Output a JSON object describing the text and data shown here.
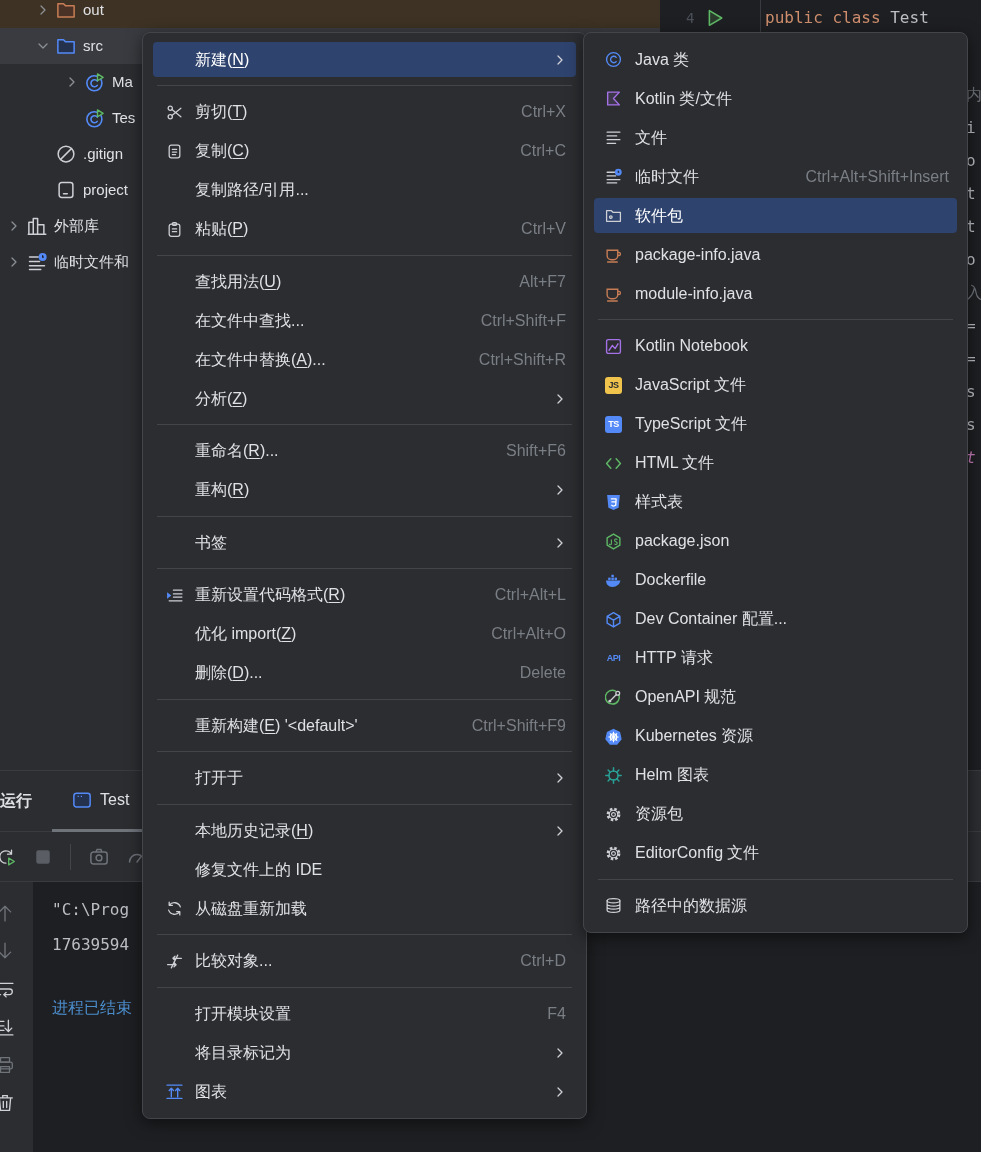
{
  "project_tree": {
    "root_children": [
      {
        "label": "out",
        "kind": "folder",
        "expanded": false,
        "selected": false,
        "excluded": true
      },
      {
        "label": "src",
        "kind": "folder",
        "expanded": true,
        "selected": true,
        "excluded": false,
        "children": [
          {
            "label": "Ma",
            "kind": "class",
            "expanded": false,
            "selected": false,
            "excluded": false
          },
          {
            "label": "Tes",
            "kind": "class",
            "selected": false,
            "excluded": false
          }
        ]
      },
      {
        "label": ".gitign",
        "kind": "ignore",
        "selected": false,
        "excluded": false
      },
      {
        "label": "project",
        "kind": "file",
        "selected": false,
        "excluded": false
      }
    ],
    "top_level": [
      {
        "label": "外部库",
        "kind": "library",
        "expanded": false,
        "selected": false,
        "excluded": false
      },
      {
        "label": "临时文件和",
        "kind": "scratch",
        "expanded": false,
        "selected": false,
        "excluded": false
      }
    ]
  },
  "editor": {
    "line_number": "4",
    "run_marker": true,
    "lines": [
      [
        {
          "text": "public class ",
          "kind": "keyword"
        },
        {
          "text": "Test",
          "kind": "plain"
        }
      ]
    ],
    "edge_fragments": [
      {
        "text": "内",
        "kind": "hint"
      },
      {
        "text": "i",
        "kind": "plain"
      },
      {
        "text": "o",
        "kind": "plain"
      },
      {
        "text": "t",
        "kind": "plain"
      },
      {
        "text": "t",
        "kind": "plain"
      },
      {
        "text": "o",
        "kind": "plain"
      },
      {
        "text": "入",
        "kind": "hint"
      },
      {
        "text": "=",
        "kind": "plain"
      },
      {
        "text": "=",
        "kind": "plain"
      },
      {
        "text": "s",
        "kind": "plain"
      },
      {
        "text": "s",
        "kind": "plain"
      },
      {
        "text": "t",
        "kind": "field"
      }
    ]
  },
  "run_panel": {
    "title": "运行",
    "tabs": [
      {
        "label": "Test",
        "selected": true
      }
    ],
    "console": [
      {
        "text": "\"C:\\Prog",
        "kind": "plain"
      },
      {
        "text": "17639594",
        "kind": "plain"
      },
      {
        "text": "进程已结束",
        "kind": "exit"
      }
    ]
  },
  "context_menu": {
    "groups": [
      [
        {
          "text": "新建(",
          "key": "N",
          "after": ")",
          "submenu": true,
          "selected": true
        }
      ],
      [
        {
          "kind": "scissors",
          "text": "剪切(",
          "key": "T",
          "after": ")",
          "shortcut": "Ctrl+X",
          "selected": false
        },
        {
          "kind": "copy",
          "text": "复制(",
          "key": "C",
          "after": ")",
          "shortcut": "Ctrl+C",
          "selected": false
        },
        {
          "text": "复制路径/引用...",
          "selected": false
        },
        {
          "kind": "paste",
          "text": "粘贴(",
          "key": "P",
          "after": ")",
          "shortcut": "Ctrl+V",
          "selected": false
        }
      ],
      [
        {
          "text": "查找用法(",
          "key": "U",
          "after": ")",
          "shortcut": "Alt+F7",
          "selected": false
        },
        {
          "text": "在文件中查找...",
          "shortcut": "Ctrl+Shift+F",
          "selected": false
        },
        {
          "text": "在文件中替换(",
          "key": "A",
          "after": ")...",
          "shortcut": "Ctrl+Shift+R",
          "selected": false
        },
        {
          "text": "分析(",
          "key": "Z",
          "after": ")",
          "submenu": true,
          "selected": false
        }
      ],
      [
        {
          "text": "重命名(",
          "key": "R",
          "after": ")...",
          "shortcut": "Shift+F6",
          "selected": false
        },
        {
          "text": "重构(",
          "key": "R",
          "after": ")",
          "submenu": true,
          "selected": false
        }
      ],
      [
        {
          "text": "书签",
          "submenu": true,
          "selected": false
        }
      ],
      [
        {
          "kind": "reformat",
          "text": "重新设置代码格式(",
          "key": "R",
          "after": ")",
          "shortcut": "Ctrl+Alt+L",
          "selected": false
        },
        {
          "text": "优化 import(",
          "key": "Z",
          "after": ")",
          "shortcut": "Ctrl+Alt+O",
          "selected": false
        },
        {
          "text": "删除(",
          "key": "D",
          "after": ")...",
          "shortcut": "Delete",
          "selected": false
        }
      ],
      [
        {
          "text": "重新构建(",
          "key": "E",
          "after": ") '<default>'",
          "shortcut": "Ctrl+Shift+F9",
          "selected": false
        }
      ],
      [
        {
          "text": "打开于",
          "submenu": true,
          "selected": false
        }
      ],
      [
        {
          "text": "本地历史记录(",
          "key": "H",
          "after": ")",
          "submenu": true,
          "selected": false
        },
        {
          "text": "修复文件上的 IDE",
          "selected": false
        },
        {
          "kind": "reload",
          "text": "从磁盘重新加载",
          "selected": false
        }
      ],
      [
        {
          "kind": "compare",
          "text": "比较对象...",
          "shortcut": "Ctrl+D",
          "selected": false
        }
      ],
      [
        {
          "text": "打开模块设置",
          "shortcut": "F4",
          "selected": false
        },
        {
          "text": "将目录标记为",
          "submenu": true,
          "selected": false
        },
        {
          "kind": "diagram",
          "text": "图表",
          "submenu": true,
          "selected": false
        }
      ]
    ]
  },
  "new_submenu": {
    "groups": [
      [
        {
          "kind": "java-class",
          "label": "Java 类",
          "selected": false
        },
        {
          "kind": "kotlin",
          "label": "Kotlin 类/文件",
          "selected": false
        },
        {
          "kind": "text-file",
          "label": "文件",
          "selected": false
        },
        {
          "kind": "scratch",
          "label": "临时文件",
          "shortcut": "Ctrl+Alt+Shift+Insert",
          "selected": false
        },
        {
          "kind": "package",
          "label": "软件包",
          "selected": true
        },
        {
          "kind": "cup",
          "label": "package-info.java",
          "selected": false
        },
        {
          "kind": "cup",
          "label": "module-info.java",
          "selected": false
        }
      ],
      [
        {
          "kind": "notebook",
          "label": "Kotlin Notebook",
          "selected": false
        },
        {
          "kind": "js",
          "icon_text": "JS",
          "label": "JavaScript 文件",
          "selected": false
        },
        {
          "kind": "ts",
          "icon_text": "TS",
          "label": "TypeScript 文件",
          "selected": false
        },
        {
          "kind": "html",
          "label": "HTML 文件",
          "selected": false
        },
        {
          "kind": "css",
          "label": "样式表",
          "selected": false
        },
        {
          "kind": "node",
          "label": "package.json",
          "selected": false
        },
        {
          "kind": "docker",
          "label": "Dockerfile",
          "selected": false
        },
        {
          "kind": "cube",
          "label": "Dev Container 配置...",
          "selected": false
        },
        {
          "kind": "api",
          "icon_text": "API",
          "label": "HTTP 请求",
          "selected": false
        },
        {
          "kind": "openapi",
          "label": "OpenAPI 规范",
          "selected": false
        },
        {
          "kind": "kubernetes",
          "label": "Kubernetes 资源",
          "selected": false
        },
        {
          "kind": "helm",
          "label": "Helm 图表",
          "selected": false
        },
        {
          "kind": "gear",
          "label": "资源包",
          "selected": false
        },
        {
          "kind": "gear",
          "label": "EditorConfig 文件",
          "selected": false
        }
      ],
      [
        {
          "kind": "database",
          "label": "路径中的数据源",
          "selected": false
        }
      ]
    ]
  }
}
